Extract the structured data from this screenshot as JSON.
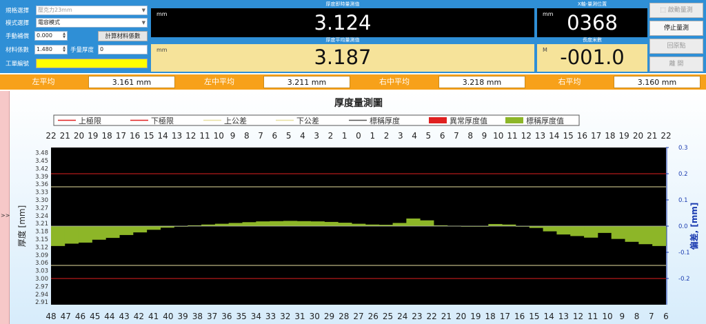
{
  "left_panel": {
    "spec_label": "規格選擇",
    "spec_value": "壓克力23mm",
    "mode_label": "模式選擇",
    "mode_value": "電容模式",
    "manual_comp_label": "手動補償",
    "manual_comp_value": "0.000",
    "calc_button": "計算材料係數",
    "material_coef_label": "材料係數",
    "material_coef_value": "1.480",
    "manual_thick_label": "手量厚度",
    "manual_thick_value": "0",
    "work_order_label": "工單編號",
    "work_order_value": ""
  },
  "displays": {
    "realtime": {
      "title": "厚度即時量測值",
      "unit": "mm",
      "value": "3.124"
    },
    "average": {
      "title": "厚度平均量測值",
      "unit": "mm",
      "value": "3.187"
    },
    "x_position": {
      "title": "X軸-量測位置",
      "unit": "mm",
      "value": "0368"
    },
    "length": {
      "title": "長度米數",
      "unit": "M",
      "value": "-001.0"
    }
  },
  "buttons": {
    "start": "啟動量測",
    "stop": "停止量測",
    "home": "回原點",
    "exit": "離 開"
  },
  "averages": [
    {
      "label": "左平均",
      "value": "3.161 mm"
    },
    {
      "label": "左中平均",
      "value": "3.211 mm"
    },
    {
      "label": "右中平均",
      "value": "3.218 mm"
    },
    {
      "label": "右平均",
      "value": "3.160 mm"
    }
  ],
  "side_marker": ">>",
  "colors": {
    "top_bg": "#2f8fd6",
    "orange_bar": "#f7a11a",
    "yellow_display": "#f6e39a",
    "limit_line": "#e02020",
    "tolerance_line": "#e8e0a0",
    "bar_fill": "#8db628",
    "abnormal": "#e02020"
  },
  "chart_data": {
    "type": "bar",
    "title": "厚度量測圖",
    "ylabel": "厚度 [mm]",
    "y2label": "偏差, [mm]",
    "baseline": 3.2,
    "ylim": [
      2.9,
      3.5
    ],
    "yticks": [
      3.48,
      3.45,
      3.42,
      3.39,
      3.36,
      3.33,
      3.3,
      3.27,
      3.24,
      3.21,
      3.18,
      3.15,
      3.12,
      3.09,
      3.06,
      3.03,
      3.0,
      2.97,
      2.94,
      2.91
    ],
    "y2ticks": [
      "0.3",
      "0.2",
      "0.1",
      "0.0",
      "-0.1",
      "-0.2"
    ],
    "y2ticks_values": [
      0.3,
      0.2,
      0.1,
      0.0,
      -0.1,
      -0.2
    ],
    "top_ticks": [
      "22",
      "21",
      "20",
      "19",
      "18",
      "17",
      "16",
      "15",
      "14",
      "13",
      "12",
      "11",
      "10",
      "9",
      "8",
      "7",
      "6",
      "5",
      "4",
      "3",
      "2",
      "1",
      "0",
      "1",
      "2",
      "3",
      "4",
      "5",
      "6",
      "7",
      "8",
      "9",
      "10",
      "11",
      "12",
      "13",
      "14",
      "15",
      "16",
      "17",
      "18",
      "19",
      "20",
      "21",
      "22"
    ],
    "bottom_ticks": [
      "48",
      "47",
      "46",
      "45",
      "44",
      "43",
      "42",
      "41",
      "40",
      "39",
      "38",
      "37",
      "36",
      "35",
      "34",
      "33",
      "32",
      "31",
      "30",
      "29",
      "28",
      "27",
      "26",
      "25",
      "24",
      "23",
      "22",
      "21",
      "20",
      "19",
      "18",
      "17",
      "16",
      "15",
      "14",
      "13",
      "12",
      "11",
      "10",
      "9",
      "8",
      "7",
      "6"
    ],
    "reference_lines": [
      {
        "name": "上極限",
        "value": 3.4,
        "kind": "limit"
      },
      {
        "name": "下極限",
        "value": 3.0,
        "kind": "limit"
      },
      {
        "name": "上公差",
        "value": 3.35,
        "kind": "tolerance"
      },
      {
        "name": "下公差",
        "value": 3.05,
        "kind": "tolerance"
      },
      {
        "name": "標稱厚度",
        "value": 3.2,
        "kind": "nominal"
      }
    ],
    "legend": [
      "上極限",
      "下極限",
      "上公差",
      "下公差",
      "標稱厚度",
      "異常厚度值",
      "標稱厚度值"
    ],
    "values": [
      3.124,
      3.133,
      3.137,
      3.148,
      3.155,
      3.166,
      3.176,
      3.186,
      3.194,
      3.199,
      3.203,
      3.206,
      3.209,
      3.212,
      3.215,
      3.218,
      3.219,
      3.22,
      3.219,
      3.218,
      3.216,
      3.213,
      3.209,
      3.206,
      3.205,
      3.212,
      3.229,
      3.222,
      3.203,
      3.201,
      3.2,
      3.2,
      3.208,
      3.206,
      3.2,
      3.193,
      3.18,
      3.168,
      3.162,
      3.156,
      3.174,
      3.151,
      3.14,
      3.131,
      3.124
    ]
  }
}
